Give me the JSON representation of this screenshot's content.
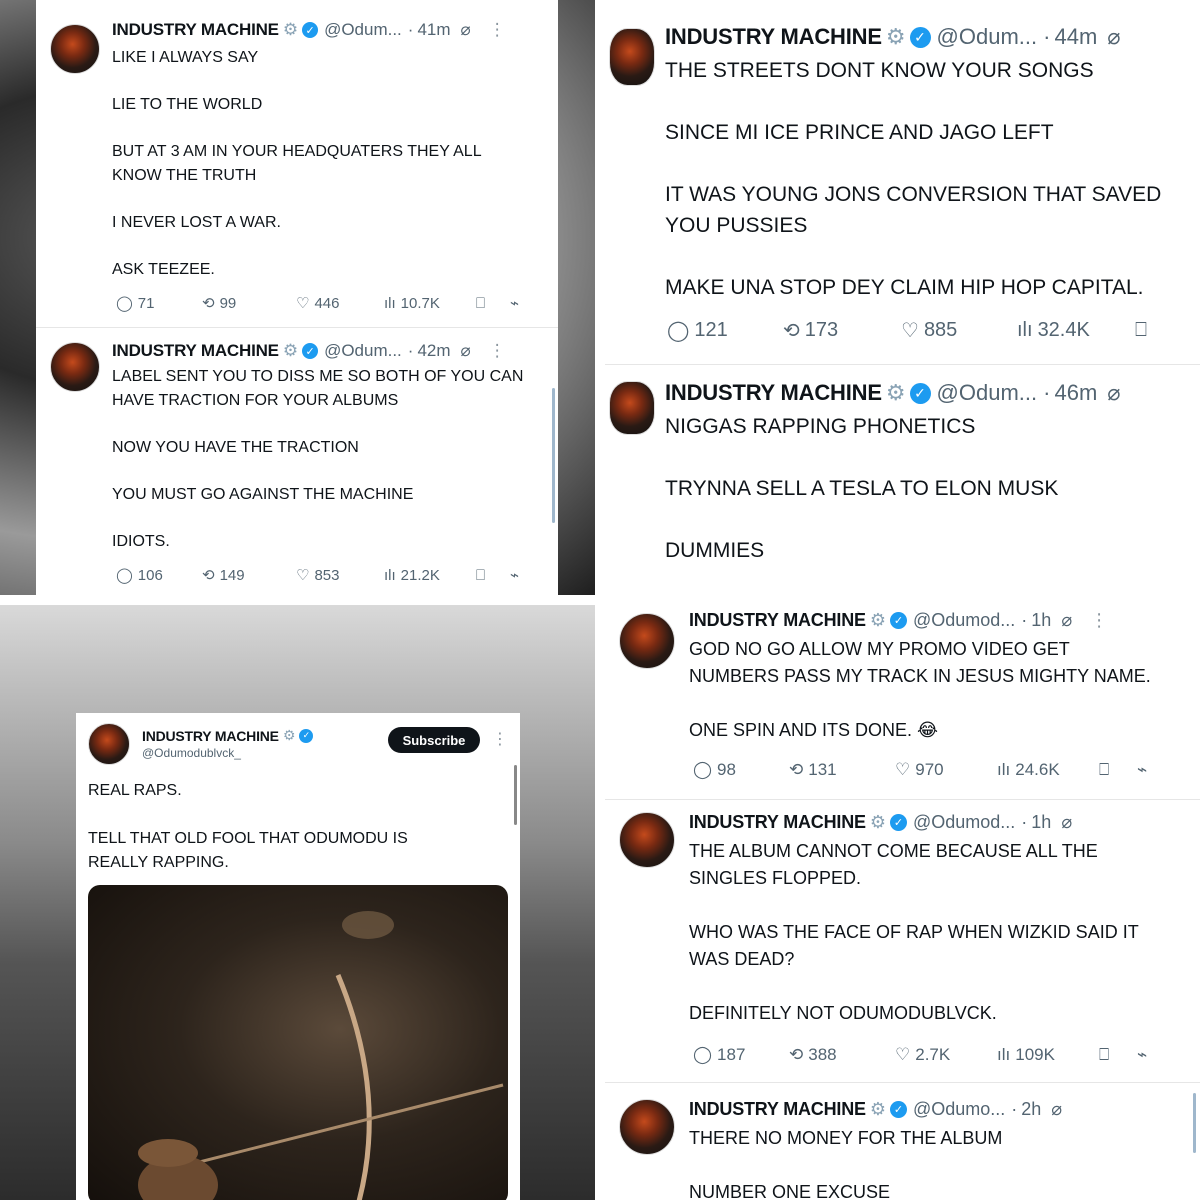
{
  "author": {
    "name": "INDUSTRY MACHINE",
    "gear_glyph": "⚙",
    "verified_glyph": "✓",
    "more_glyph": "⋮",
    "grok_glyph": "⌀"
  },
  "icons": {
    "reply": "◯",
    "retweet": "⟲",
    "like": "♡",
    "views": "ılı",
    "bookmark": "⎕",
    "share": "⌁"
  },
  "colors": {
    "verified": "#1d9bf0",
    "text": "#0f1419",
    "muted": "#536471"
  },
  "tweets": [
    {
      "handle": "@Odum...",
      "time": "41m",
      "text": "LIKE I ALWAYS SAY\n\nLIE TO THE WORLD\n\nBUT AT 3 AM IN YOUR HEADQUATERS THEY ALL\nKNOW THE TRUTH\n\nI NEVER LOST A WAR.\n\nASK TEEZEE.",
      "replies": "71",
      "retweets": "99",
      "likes": "446",
      "views": "10.7K"
    },
    {
      "handle": "@Odum...",
      "time": "42m",
      "text": "LABEL SENT YOU TO DISS ME SO BOTH OF YOU CAN\nHAVE TRACTION FOR YOUR ALBUMS\n\nNOW YOU HAVE THE TRACTION\n\nYOU MUST GO AGAINST THE MACHINE\n\nIDIOTS.",
      "replies": "106",
      "retweets": "149",
      "likes": "853",
      "views": "21.2K"
    },
    {
      "handle": "@Odum...",
      "time": "44m",
      "text": "THE STREETS DONT KNOW YOUR SONGS\n\nSINCE MI ICE PRINCE AND JAGO LEFT\n\nIT WAS YOUNG JONS CONVERSION THAT SAVED\nYOU PUSSIES\n\nMAKE UNA STOP DEY CLAIM HIP HOP CAPITAL.",
      "replies": "121",
      "retweets": "173",
      "likes": "885",
      "views": "32.4K"
    },
    {
      "handle": "@Odum...",
      "time": "46m",
      "text": "NIGGAS RAPPING PHONETICS\n\nTRYNNA SELL A TESLA TO ELON MUSK\n\nDUMMIES"
    },
    {
      "handle": "@Odumodublvck_",
      "subscribe_label": "Subscribe",
      "text": "REAL RAPS.\n\nTELL THAT OLD FOOL THAT ODUMODU IS\nREALLY RAPPING."
    },
    {
      "handle": "@Odumod...",
      "time": "1h",
      "text": "GOD NO GO ALLOW MY PROMO VIDEO GET\nNUMBERS PASS MY TRACK IN JESUS MIGHTY NAME.\n\nONE SPIN AND ITS DONE. 😂",
      "replies": "98",
      "retweets": "131",
      "likes": "970",
      "views": "24.6K"
    },
    {
      "handle": "@Odumod...",
      "time": "1h",
      "text": "THE ALBUM CANNOT COME BECAUSE ALL THE\nSINGLES FLOPPED.\n\nWHO WAS THE FACE OF RAP WHEN WIZKID SAID IT\nWAS DEAD?\n\nDEFINITELY NOT ODUMODUBLVCK.",
      "replies": "187",
      "retweets": "388",
      "likes": "2.7K",
      "views": "109K"
    },
    {
      "handle": "@Odumo...",
      "time": "2h",
      "text": "THERE NO MONEY FOR THE ALBUM\n\nNUMBER ONE EXCUSE"
    }
  ]
}
